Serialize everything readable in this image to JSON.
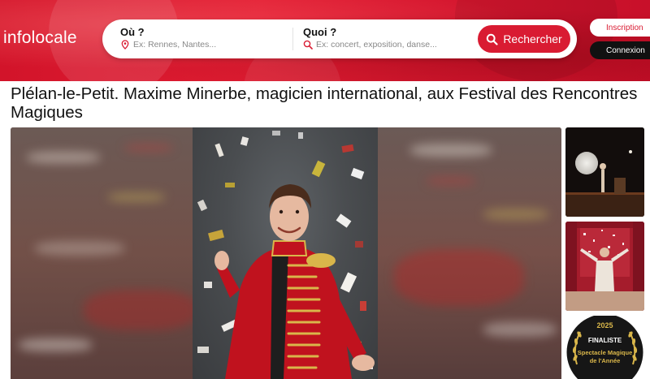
{
  "header": {
    "logo": "infolocale",
    "where_label": "Où ?",
    "where_placeholder": "Ex: Rennes, Nantes...",
    "what_label": "Quoi ?",
    "what_placeholder": "Ex: concert, exposition, danse...",
    "search_button": "Rechercher",
    "signup_button": "Inscription",
    "login_button": "Connexion"
  },
  "article": {
    "title": "Plélan-le-Petit. Maxime Minerbe, magicien international, aux Festival des Rencontres Magiques"
  },
  "gallery": {
    "badge_year": "2025",
    "badge_status": "FINALISTE",
    "badge_award_line1": "Spectacle Magique",
    "badge_award_line2": "de l'Année"
  },
  "colors": {
    "brand_red": "#d91b32",
    "dark": "#111111",
    "gold": "#d9b64a"
  },
  "icons": {
    "where": "map-pin-icon",
    "what": "search-icon",
    "search_button": "search-icon"
  }
}
